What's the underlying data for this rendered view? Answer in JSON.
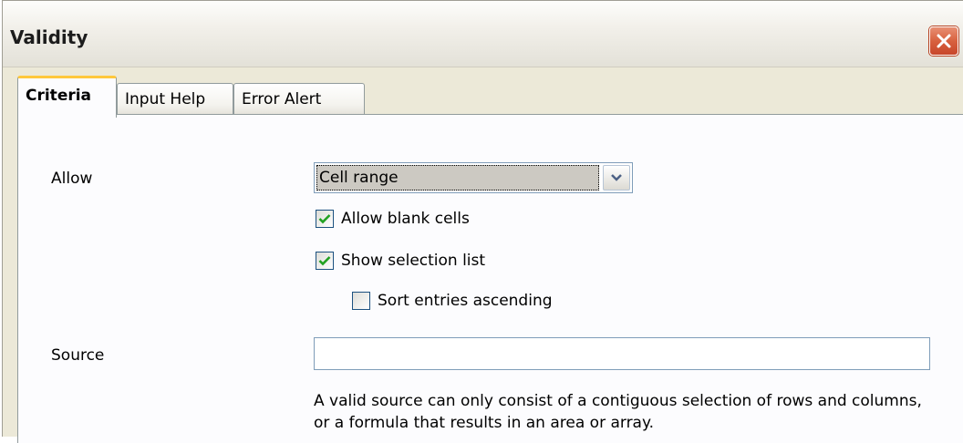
{
  "window": {
    "title": "Validity"
  },
  "tabs": [
    {
      "label": "Criteria",
      "active": true
    },
    {
      "label": "Input Help",
      "active": false
    },
    {
      "label": "Error Alert",
      "active": false
    }
  ],
  "criteria": {
    "allow_label": "Allow",
    "allow_value": "Cell range",
    "allow_blank": {
      "label": "Allow blank cells",
      "checked": true
    },
    "show_list": {
      "label": "Show selection list",
      "checked": true
    },
    "sort_asc": {
      "label": "Sort entries ascending",
      "checked": false
    },
    "source_label": "Source",
    "source_value": "",
    "help": "A valid source can only consist of a contiguous selection of rows and columns, or a formula that results in an area or array."
  },
  "colors": {
    "tab_highlight": "#ffc83c",
    "close_button": "#d8613f",
    "checkmark": "#21a121"
  }
}
